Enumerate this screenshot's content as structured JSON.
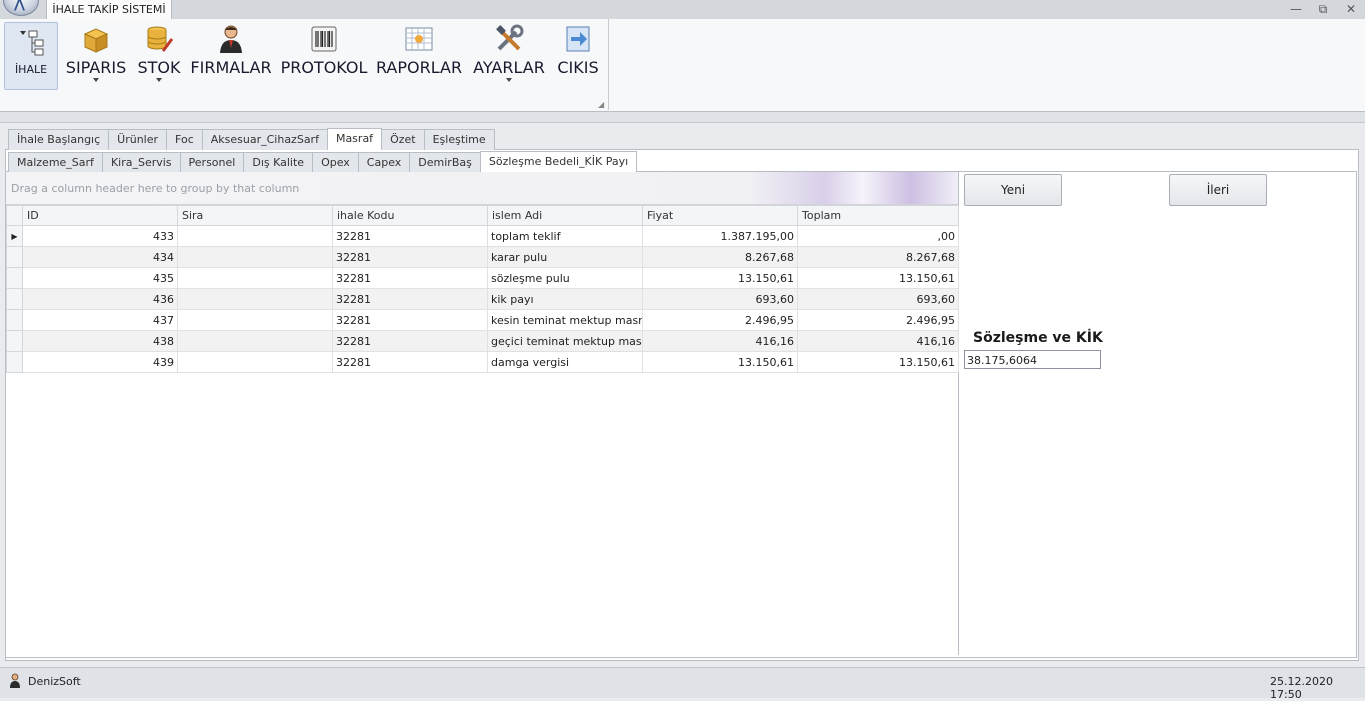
{
  "window": {
    "tab_title": "İHALE TAKİP SİSTEMİ",
    "controls": {
      "minimize": "—",
      "restore": "⧉",
      "close": "✕"
    }
  },
  "ribbon": {
    "buttons": [
      {
        "label": "İHALE",
        "icon": "tree-icon"
      },
      {
        "label": "SIPARIS",
        "icon": "package-icon"
      },
      {
        "label": "STOK",
        "icon": "database-icon"
      },
      {
        "label": "FIRMALAR",
        "icon": "person-icon"
      },
      {
        "label": "PROTOKOL",
        "icon": "barcode-icon"
      },
      {
        "label": "RAPORLAR",
        "icon": "report-grid-icon"
      },
      {
        "label": "AYARLAR",
        "icon": "tools-icon"
      },
      {
        "label": "CIKIS",
        "icon": "exit-icon"
      }
    ]
  },
  "tabs_main": [
    "İhale Başlangıç",
    "Ürünler",
    "Foc",
    "Aksesuar_CihazSarf",
    "Masraf",
    "Özet",
    "Eşleştime"
  ],
  "tabs_sub": [
    "Malzeme_Sarf",
    "Kira_Servis",
    "Personel",
    "Dış Kalite",
    "Opex",
    "Capex",
    "DemirBaş",
    "Sözleşme Bedeli_KİK Payı"
  ],
  "grid": {
    "group_hint": "Drag a column header here to group by that column",
    "columns": [
      "ID",
      "Sira",
      "ihale Kodu",
      "islem Adi",
      "Fiyat",
      "Toplam"
    ],
    "rows": [
      [
        "433",
        "",
        "32281",
        "toplam teklif",
        "1.387.195,00",
        ",00"
      ],
      [
        "434",
        "",
        "32281",
        "karar pulu",
        "8.267,68",
        "8.267,68"
      ],
      [
        "435",
        "",
        "32281",
        "sözleşme pulu",
        "13.150,61",
        "13.150,61"
      ],
      [
        "436",
        "",
        "32281",
        "kik payı",
        "693,60",
        "693,60"
      ],
      [
        "437",
        "",
        "32281",
        "kesin teminat mektup masrafi",
        "2.496,95",
        "2.496,95"
      ],
      [
        "438",
        "",
        "32281",
        "geçici teminat mektup masrafi",
        "416,16",
        "416,16"
      ],
      [
        "439",
        "",
        "32281",
        "damga vergisi",
        "13.150,61",
        "13.150,61"
      ]
    ]
  },
  "side": {
    "yeni_label": "Yeni",
    "ileri_label": "İleri",
    "sozlesme_label": "Sözleşme ve KİK",
    "sozlesme_value": "38.175,6064"
  },
  "status": {
    "user": "DenizSoft",
    "datetime": "25.12.2020 17:50"
  }
}
